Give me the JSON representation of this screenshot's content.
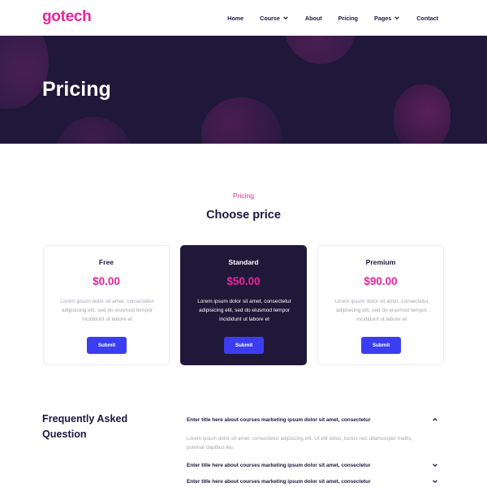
{
  "brand": {
    "logo": "gotech",
    "accent": "#e8259b",
    "dark": "#1f1838",
    "button": "#3b3ef0"
  },
  "nav": {
    "items": [
      {
        "label": "Home",
        "dropdown": false
      },
      {
        "label": "Course",
        "dropdown": true
      },
      {
        "label": "About",
        "dropdown": false
      },
      {
        "label": "Pricing",
        "dropdown": false
      },
      {
        "label": "Pages",
        "dropdown": true
      },
      {
        "label": "Contact",
        "dropdown": false
      }
    ]
  },
  "hero": {
    "title": "Pricing"
  },
  "pricing_section": {
    "eyebrow": "Pricing",
    "title": "Choose price"
  },
  "plans": [
    {
      "name": "Free",
      "price": "$0.00",
      "description": "Lorem ipsum dolor sit amet, consectetur adipisicing elit, sed do eiusmod tempor incididunt ut labore et",
      "button": "Submit"
    },
    {
      "name": "Standard",
      "price": "$50.00",
      "description": "Lorem ipsum dolor sit amet, consectetur adipisicing elit, sed do eiusmod tempor incididunt ut labore et",
      "button": "Submit"
    },
    {
      "name": "Premium",
      "price": "$90.00",
      "description": "Lorem ipsum dolor sit amet, consectetur adipisicing elit, sed do eiusmod tempor incididunt ut labore et",
      "button": "Submit"
    }
  ],
  "faq": {
    "title": "Frequently Asked Question",
    "items": [
      {
        "question": "Enter title here about courses marketing ipsum dolor sit amet, consectetur",
        "answer": "Lorem ipsum dolor sit amet, consectetur adipiscing elit. Ut elit tellus, luctus nec ullamcorper mattis, pulvinar dapibus leo.",
        "expanded": true
      },
      {
        "question": "Enter title here about courses marketing ipsum dolor sit amet, consectetur",
        "answer": "",
        "expanded": false
      },
      {
        "question": "Enter title here about courses marketing ipsum dolor sit amet, consectetur",
        "answer": "",
        "expanded": false
      }
    ]
  }
}
